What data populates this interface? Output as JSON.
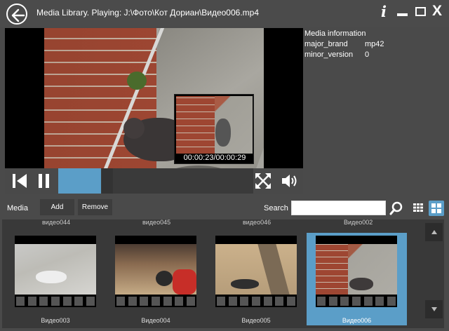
{
  "window": {
    "title": "Media Library. Playing: J:\\Фото\\Кот Дориан\\Видео006.mp4",
    "info_glyph": "i",
    "close_glyph": "X"
  },
  "player": {
    "preview_time": "00:00:23/00:00:29",
    "progress_fraction": 0.22
  },
  "info": {
    "title": "Media information",
    "rows": [
      {
        "key": "major_brand",
        "value": "mp42"
      },
      {
        "key": "minor_version",
        "value": "0"
      }
    ]
  },
  "toolbar": {
    "media_label": "Media",
    "add_label": "Add",
    "remove_label": "Remove",
    "search_label": "Search",
    "search_value": ""
  },
  "gallery": {
    "partial_labels": [
      "видео044",
      "видео045",
      "видео046",
      "Видео002"
    ],
    "tiles": [
      {
        "label": "Видео003",
        "selected": false
      },
      {
        "label": "Видео004",
        "selected": false
      },
      {
        "label": "Видео005",
        "selected": false
      },
      {
        "label": "Видео006",
        "selected": true
      }
    ]
  },
  "colors": {
    "accent": "#5b9ec8",
    "background": "#4a4a4a"
  }
}
